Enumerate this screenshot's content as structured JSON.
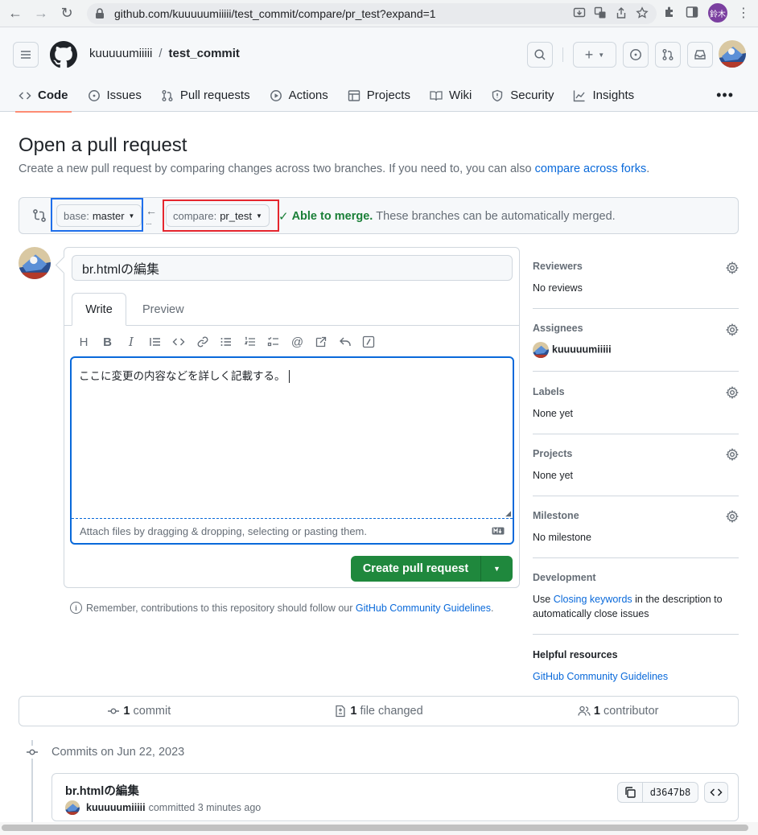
{
  "browser": {
    "url": "github.com/kuuuuumiiiii/test_commit/compare/pr_test?expand=1",
    "profile_initials": "鈴木"
  },
  "header": {
    "owner": "kuuuuumiiiii",
    "separator": "/",
    "repo": "test_commit"
  },
  "repo_tabs": [
    {
      "label": "Code",
      "icon": "code-icon",
      "active": true
    },
    {
      "label": "Issues",
      "icon": "issue-icon"
    },
    {
      "label": "Pull requests",
      "icon": "pull-request-icon"
    },
    {
      "label": "Actions",
      "icon": "play-icon"
    },
    {
      "label": "Projects",
      "icon": "table-icon"
    },
    {
      "label": "Wiki",
      "icon": "book-icon"
    },
    {
      "label": "Security",
      "icon": "shield-icon"
    },
    {
      "label": "Insights",
      "icon": "graph-icon"
    }
  ],
  "page": {
    "title": "Open a pull request",
    "subtitle": "Create a new pull request by comparing changes across two branches. If you need to, you can also ",
    "subtitle_link": "compare across forks",
    "subtitle_end": "."
  },
  "compare": {
    "base_label": "base:",
    "base_value": "master",
    "compare_label": "compare:",
    "compare_value": "pr_test",
    "merge_ok": "Able to merge.",
    "merge_text": "These branches can be automatically merged."
  },
  "form": {
    "title_value": "br.htmlの編集",
    "tab_write": "Write",
    "tab_preview": "Preview",
    "body_value": "ここに変更の内容などを詳しく記載する。",
    "attach_hint": "Attach files by dragging & dropping, selecting or pasting them.",
    "create_button": "Create pull request"
  },
  "remember": {
    "text": "Remember, contributions to this repository should follow our ",
    "link": "GitHub Community Guidelines",
    "end": "."
  },
  "sidebar": {
    "reviewers_h": "Reviewers",
    "reviewers_v": "No reviews",
    "assignees_h": "Assignees",
    "assignees_v": "kuuuuumiiiii",
    "labels_h": "Labels",
    "labels_v": "None yet",
    "projects_h": "Projects",
    "projects_v": "None yet",
    "milestone_h": "Milestone",
    "milestone_v": "No milestone",
    "development_h": "Development",
    "development_pre": "Use ",
    "development_link": "Closing keywords",
    "development_post": " in the description to automatically close issues",
    "helpful_h": "Helpful resources",
    "helpful_link": "GitHub Community Guidelines"
  },
  "stats": {
    "commits_n": "1",
    "commits_label": "commit",
    "files_n": "1",
    "files_label": "file changed",
    "contrib_n": "1",
    "contrib_label": "contributor"
  },
  "commits": {
    "date_label": "Commits on Jun 22, 2023",
    "title": "br.htmlの編集",
    "author": "kuuuuumiiiii",
    "meta": "committed 3 minutes ago",
    "sha": "d3647b8"
  },
  "colors": {
    "accent": "#0969da",
    "green": "#1f883d",
    "highlight_blue": "#1f6feb",
    "highlight_red": "#e5262e",
    "tab_underline": "#fd8c73"
  }
}
